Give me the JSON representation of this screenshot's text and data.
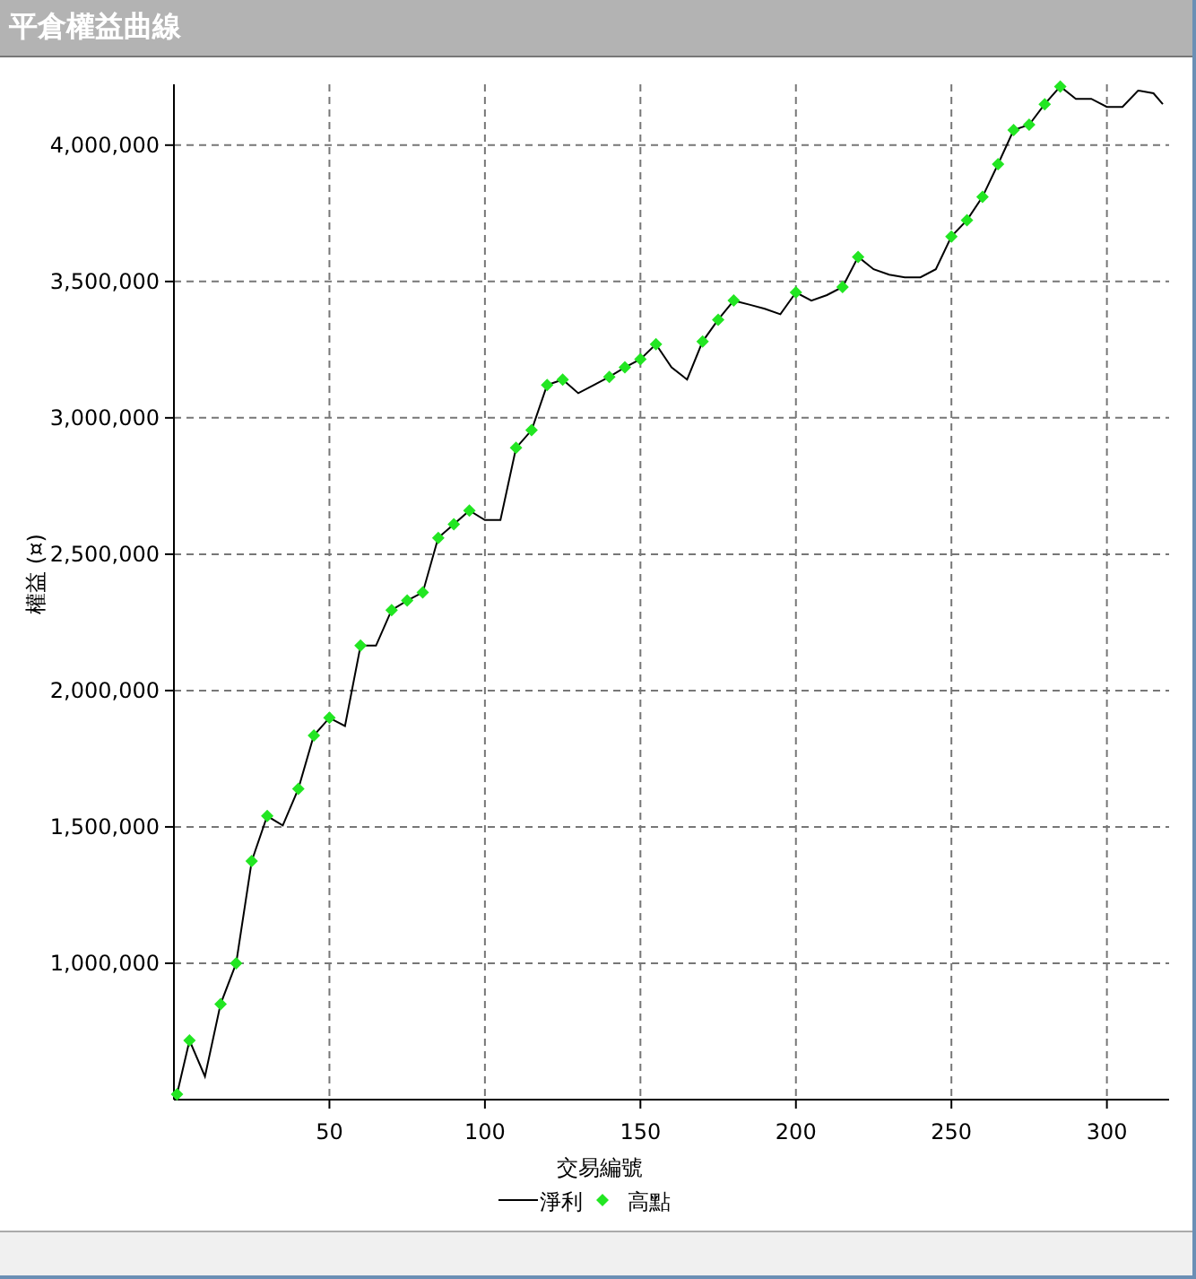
{
  "window": {
    "title": "平倉權益曲線"
  },
  "chart": {
    "chart_data": {
      "type": "line",
      "xlabel": "交易編號",
      "ylabel": "權益 (¤)",
      "x": [
        1,
        5,
        10,
        15,
        20,
        25,
        30,
        35,
        40,
        45,
        50,
        55,
        60,
        65,
        70,
        75,
        80,
        85,
        90,
        95,
        100,
        105,
        110,
        115,
        120,
        125,
        130,
        135,
        140,
        145,
        150,
        155,
        160,
        165,
        170,
        175,
        180,
        185,
        190,
        195,
        200,
        205,
        210,
        215,
        220,
        225,
        230,
        235,
        240,
        245,
        250,
        255,
        260,
        265,
        270,
        275,
        280,
        285,
        290,
        295,
        300,
        305,
        310,
        315,
        318
      ],
      "series": [
        {
          "name": "淨利",
          "color": "#000000",
          "type": "line",
          "values": [
            520000,
            717000,
            585000,
            850000,
            1000000,
            1375000,
            1540000,
            1505000,
            1640000,
            1835000,
            1900000,
            1870000,
            2165000,
            2165000,
            2295000,
            2330000,
            2360000,
            2560000,
            2610000,
            2660000,
            2625000,
            2625000,
            2890000,
            2955000,
            3120000,
            3140000,
            3090000,
            3120000,
            3150000,
            3185000,
            3215000,
            3270000,
            3185000,
            3140000,
            3280000,
            3360000,
            3430000,
            3415000,
            3400000,
            3380000,
            3460000,
            3430000,
            3450000,
            3480000,
            3590000,
            3545000,
            3525000,
            3515000,
            3515000,
            3545000,
            3665000,
            3725000,
            3810000,
            3930000,
            4055000,
            4075000,
            4150000,
            4215000,
            4170000,
            4170000,
            4140000,
            4140000,
            4200000,
            4190000,
            4150000
          ]
        },
        {
          "name": "高點",
          "color": "#22e622",
          "type": "scatter",
          "values": [
            520000,
            717000,
            null,
            850000,
            1000000,
            1375000,
            1540000,
            null,
            1640000,
            1835000,
            1900000,
            null,
            2165000,
            null,
            2295000,
            2330000,
            2360000,
            2560000,
            2610000,
            2660000,
            null,
            null,
            2890000,
            2955000,
            3120000,
            3140000,
            null,
            null,
            3150000,
            3185000,
            3215000,
            3270000,
            null,
            null,
            3280000,
            3360000,
            3430000,
            null,
            null,
            null,
            3460000,
            null,
            null,
            3480000,
            3590000,
            null,
            null,
            null,
            null,
            null,
            3665000,
            3725000,
            3810000,
            3930000,
            4055000,
            4075000,
            4150000,
            4215000,
            null,
            null,
            null,
            null,
            null,
            null,
            null
          ]
        }
      ],
      "grid": true,
      "legend": "bottom",
      "xlim": [
        0,
        320
      ],
      "ylim": [
        500000,
        4223000
      ],
      "xticks": [
        50,
        100,
        150,
        200,
        250,
        300
      ],
      "yticks": [
        {
          "value": 1000000,
          "label": "1,000,000"
        },
        {
          "value": 1500000,
          "label": "1,500,000"
        },
        {
          "value": 2000000,
          "label": "2,000,000"
        },
        {
          "value": 2500000,
          "label": "2,500,000"
        },
        {
          "value": 3000000,
          "label": "3,000,000"
        },
        {
          "value": 3500000,
          "label": "3,500,000"
        },
        {
          "value": 4000000,
          "label": "4,000,000"
        }
      ]
    }
  }
}
